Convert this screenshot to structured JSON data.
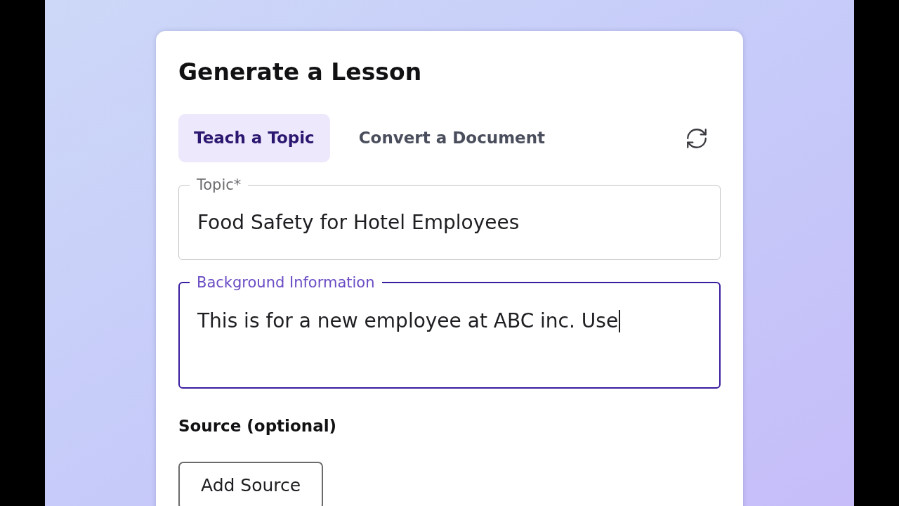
{
  "card": {
    "title": "Generate a Lesson"
  },
  "tabs": [
    {
      "label": "Teach a Topic",
      "selected": true
    },
    {
      "label": "Convert a Document",
      "selected": false
    }
  ],
  "fields": [
    {
      "kind": "input",
      "label": "Topic*",
      "value": "Food Safety for Hotel Employees",
      "focused": false
    },
    {
      "kind": "textarea",
      "label": "Background Information",
      "value": "This is for a new employee at ABC inc. Use",
      "focused": true
    }
  ],
  "source": {
    "heading": "Source (optional)",
    "button": "Add Source"
  }
}
